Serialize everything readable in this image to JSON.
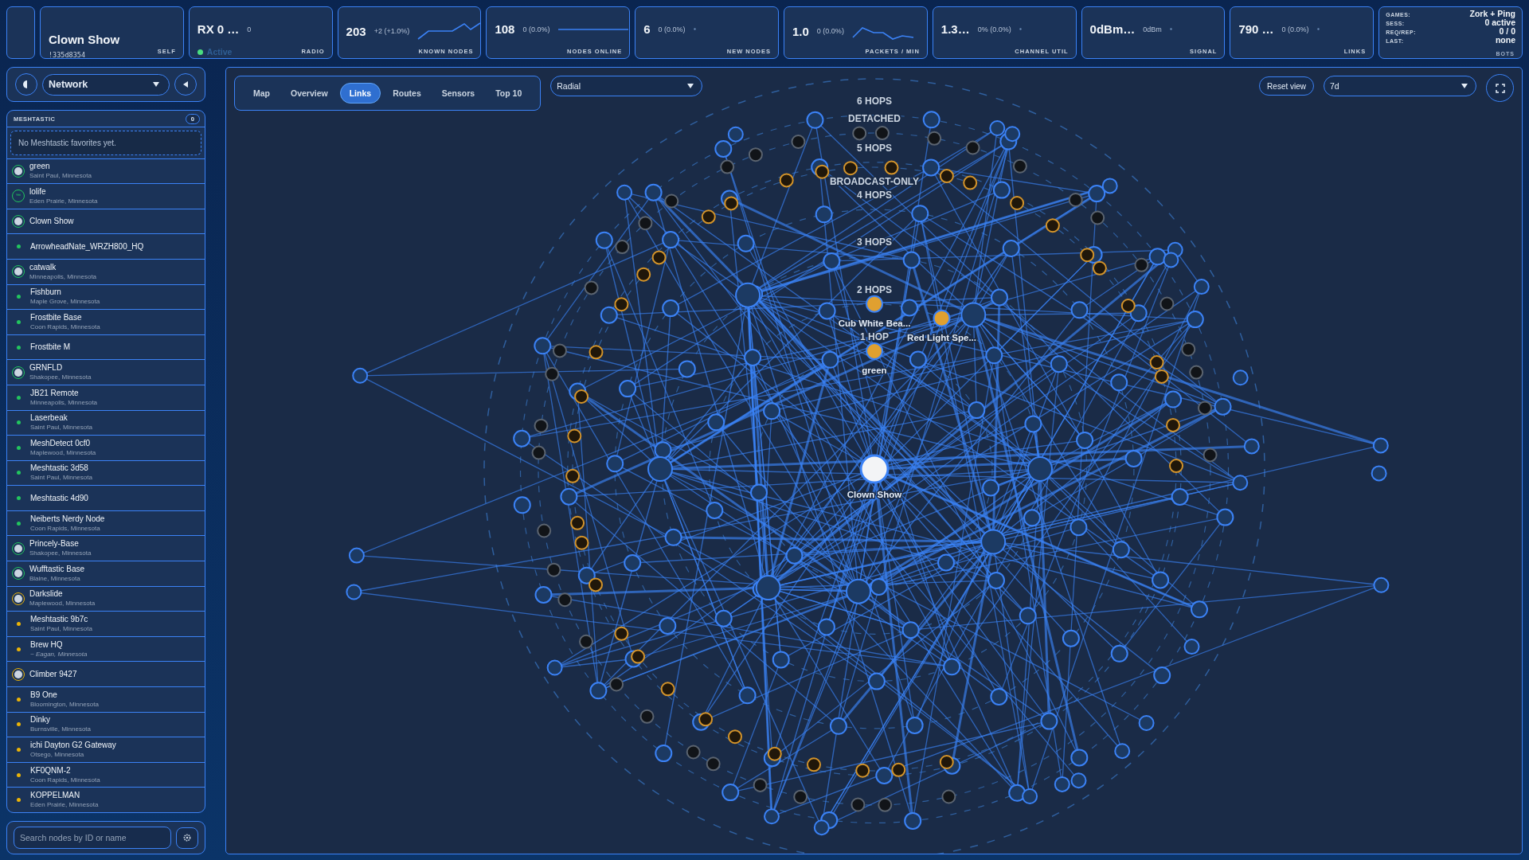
{
  "stats_bar": {
    "self": {
      "name": "Clown Show",
      "id": "!335d8354",
      "label": "SELF"
    },
    "radio": {
      "value": "RX 0 …",
      "sub": "0",
      "status": "Active",
      "active": true,
      "label": "RADIO"
    },
    "stats": [
      {
        "value": "203",
        "delta": "+2 (+1.0%)",
        "label": "KNOWN NODES"
      },
      {
        "value": "108",
        "delta": "0 (0.0%)",
        "label": "NODES ONLINE"
      },
      {
        "value": "6",
        "delta": "0 (0.0%)",
        "label": "NEW NODES"
      },
      {
        "value": "1.0",
        "delta": "0 (0.0%)",
        "label": "PACKETS / MIN"
      },
      {
        "value": "1.3…",
        "delta": "0% (0.0%)",
        "label": "CHANNEL UTIL"
      },
      {
        "value": "0dBm…",
        "delta": "0dBm",
        "label": "SIGNAL"
      },
      {
        "value": "790 …",
        "delta": "0 (0.0%)",
        "label": "LINKS"
      }
    ],
    "bots": {
      "rows": [
        {
          "key": "GAMES:",
          "value": "Zork + Ping"
        },
        {
          "key": "SESS:",
          "value": "0 active"
        },
        {
          "key": "REQ/REP:",
          "value": "0 / 0"
        },
        {
          "key": "LAST:",
          "value": "none"
        }
      ],
      "label": "BOTS"
    }
  },
  "sidebar": {
    "view": "Network",
    "section": {
      "title": "MESHTASTIC",
      "count": "0",
      "empty_note": "No Meshtastic favorites yet."
    },
    "nodes": [
      {
        "name": "green",
        "location": "Saint Paul, Minnesota",
        "approximate": false,
        "kind": "avatar",
        "color": "#22c55e"
      },
      {
        "name": "lolife",
        "location": "Eden Prairie, Minnesota",
        "approximate": false,
        "kind": "avatar",
        "glyph": "™",
        "color": "#22c55e"
      },
      {
        "name": "Clown Show",
        "kind": "avatar",
        "color": "#22c55e"
      },
      {
        "name": "ArrowheadNate_WRZH800_HQ",
        "kind": "dot",
        "color": "#22c55e"
      },
      {
        "name": "catwalk",
        "location": "Minneapolis, Minnesota",
        "approximate": false,
        "kind": "avatar",
        "color": "#22c55e"
      },
      {
        "name": "Fishburn",
        "location": "Maple Grove, Minnesota",
        "approximate": false,
        "kind": "dot",
        "color": "#22c55e"
      },
      {
        "name": "Frostbite Base",
        "location": "Coon Rapids, Minnesota",
        "approximate": false,
        "kind": "dot",
        "color": "#22c55e"
      },
      {
        "name": "Frostbite M",
        "kind": "dot",
        "color": "#22c55e"
      },
      {
        "name": "GRNFLD",
        "location": "Shakopee, Minnesota",
        "approximate": false,
        "kind": "avatar",
        "color": "#22c55e"
      },
      {
        "name": "JB21 Remote",
        "location": "Minneapolis, Minnesota",
        "approximate": false,
        "kind": "dot",
        "color": "#22c55e"
      },
      {
        "name": "Laserbeak",
        "location": "Saint Paul, Minnesota",
        "approximate": false,
        "kind": "dot",
        "color": "#22c55e"
      },
      {
        "name": "MeshDetect 0cf0",
        "location": "Maplewood, Minnesota",
        "approximate": false,
        "kind": "dot",
        "color": "#22c55e"
      },
      {
        "name": "Meshtastic 3d58",
        "location": "Saint Paul, Minnesota",
        "approximate": false,
        "kind": "dot",
        "color": "#22c55e"
      },
      {
        "name": "Meshtastic 4d90",
        "kind": "dot",
        "color": "#22c55e"
      },
      {
        "name": "Neiberts Nerdy Node",
        "location": "Coon Rapids, Minnesota",
        "approximate": false,
        "kind": "dot",
        "color": "#22c55e"
      },
      {
        "name": "Princely-Base",
        "location": "Shakopee, Minnesota",
        "approximate": false,
        "kind": "avatar",
        "color": "#22c55e"
      },
      {
        "name": "Wufftastic Base",
        "location": "Blaine, Minnesota",
        "approximate": false,
        "kind": "avatar",
        "color": "#22c55e"
      },
      {
        "name": "Darkslide",
        "location": "Maplewood, Minnesota",
        "approximate": false,
        "kind": "avatar",
        "color": "#eab308"
      },
      {
        "name": "Meshtastic 9b7c",
        "location": "Saint Paul, Minnesota",
        "approximate": false,
        "kind": "dot",
        "color": "#eab308"
      },
      {
        "name": "Brew HQ",
        "location": "~ Eagan, Minnesota",
        "approximate": true,
        "kind": "dot",
        "color": "#eab308"
      },
      {
        "name": "Climber 9427",
        "kind": "avatar",
        "color": "#eab308"
      },
      {
        "name": "B9 One",
        "location": "Bloomington, Minnesota",
        "approximate": false,
        "kind": "dot",
        "color": "#eab308"
      },
      {
        "name": "Dinky",
        "location": "Burnsville, Minnesota",
        "approximate": false,
        "kind": "dot",
        "color": "#eab308"
      },
      {
        "name": "ichi Dayton G2 Gateway",
        "location": "Otsego, Minnesota",
        "approximate": false,
        "kind": "dot",
        "color": "#eab308"
      },
      {
        "name": "KF0QNM-2",
        "location": "Coon Rapids, Minnesota",
        "approximate": false,
        "kind": "dot",
        "color": "#eab308"
      },
      {
        "name": "KOPPELMAN",
        "location": "Eden Prairie, Minnesota",
        "approximate": false,
        "kind": "dot",
        "color": "#eab308"
      }
    ],
    "search": {
      "placeholder": "Search nodes by ID or name"
    }
  },
  "graph": {
    "tabs": [
      {
        "label": "Map",
        "selected": false
      },
      {
        "label": "Overview",
        "selected": false
      },
      {
        "label": "Links",
        "selected": true
      },
      {
        "label": "Routes",
        "selected": false
      },
      {
        "label": "Sensors",
        "selected": false
      },
      {
        "label": "Top 10",
        "selected": false
      }
    ],
    "layout_select": "Radial",
    "reset_button": "Reset view",
    "range_select": "7d",
    "center": {
      "label": "Clown Show"
    },
    "rings": [
      {
        "label": "6 HOPS",
        "kind": "hop"
      },
      {
        "label": "DETACHED",
        "kind": "detached"
      },
      {
        "label": "5 HOPS",
        "kind": "hop"
      },
      {
        "label": "BROADCAST-ONLY",
        "kind": "broadcast"
      },
      {
        "label": "4 HOPS",
        "kind": "hop"
      },
      {
        "label": "3 HOPS",
        "kind": "hop"
      },
      {
        "label": "2 HOPS",
        "kind": "hop",
        "nodes": [
          {
            "label": "Cub White Bea..."
          },
          {
            "label": "Red Light Spe..."
          }
        ]
      },
      {
        "label": "1 HOP",
        "kind": "hop",
        "nodes": [
          {
            "label": "green"
          }
        ]
      }
    ]
  }
}
